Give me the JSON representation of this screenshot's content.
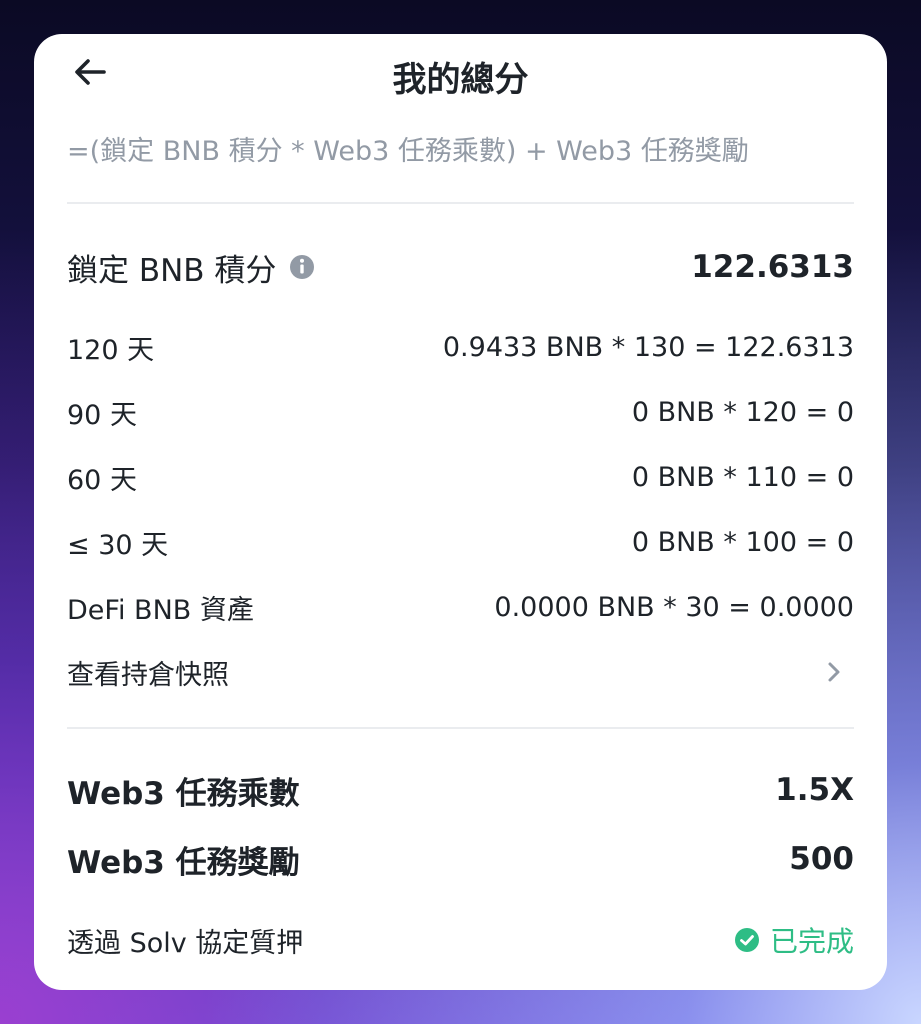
{
  "header": {
    "title": "我的總分",
    "back_icon": "arrow-left-icon"
  },
  "formula": "=(鎖定 BNB 積分 * Web3 任務乘數) + Web3 任務獎勵",
  "locked_points": {
    "label": "鎖定 BNB 積分",
    "info_icon": "info-icon",
    "value": "122.6313"
  },
  "tiers": [
    {
      "label": "120 天",
      "value": "0.9433 BNB * 130 = 122.6313"
    },
    {
      "label": "90 天",
      "value": "0 BNB * 120 = 0"
    },
    {
      "label": "60 天",
      "value": "0 BNB * 110 = 0"
    },
    {
      "label": "≤ 30 天",
      "value": "0 BNB * 100 = 0"
    },
    {
      "label": "DeFi BNB 資產",
      "value": "0.0000 BNB * 30 = 0.0000"
    }
  ],
  "snapshot": {
    "label": "查看持倉快照",
    "icon": "chevron-right-icon"
  },
  "multiplier": {
    "label": "Web3 任務乘數",
    "value": "1.5X"
  },
  "reward": {
    "label": "Web3 任務獎勵",
    "value": "500"
  },
  "solv": {
    "label": "透過 Solv 協定質押",
    "status": "已完成",
    "status_icon": "check-circle-icon"
  },
  "colors": {
    "text_primary": "#1e2329",
    "text_secondary": "#929aa5",
    "success": "#2ebd85",
    "divider": "#eaecef"
  }
}
